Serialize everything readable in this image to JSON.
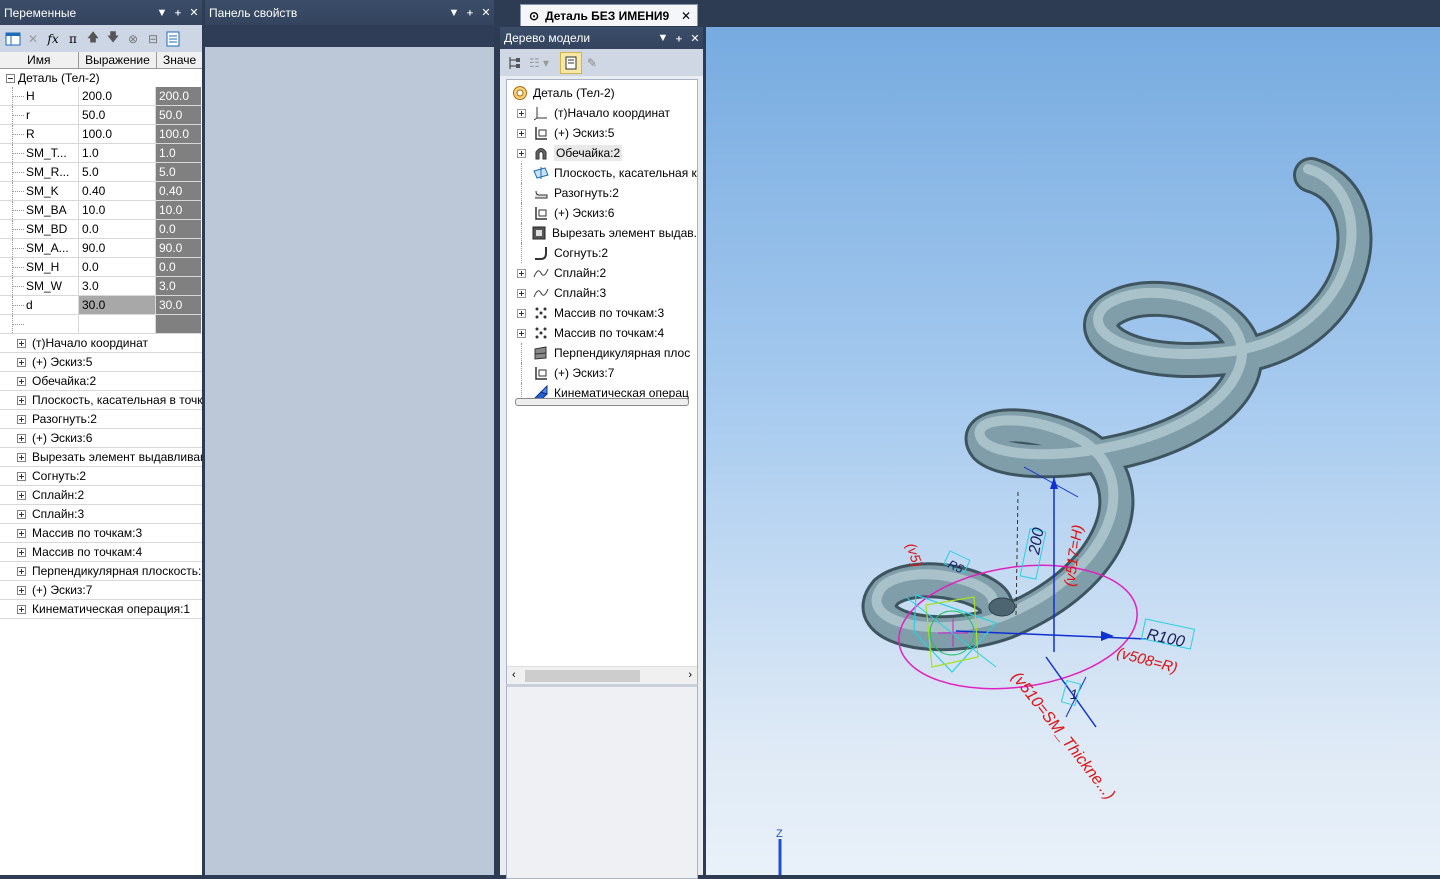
{
  "variables_panel": {
    "title": "Переменные",
    "columns": [
      "Имя",
      "Выражение",
      "Значе"
    ],
    "root": "Деталь (Тел-2)",
    "rows": [
      {
        "name": "H",
        "expr": "200.0",
        "value": "200.0"
      },
      {
        "name": "r",
        "expr": "50.0",
        "value": "50.0"
      },
      {
        "name": "R",
        "expr": "100.0",
        "value": "100.0"
      },
      {
        "name": "SM_T...",
        "expr": "1.0",
        "value": "1.0"
      },
      {
        "name": "SM_R...",
        "expr": "5.0",
        "value": "5.0"
      },
      {
        "name": "SM_K",
        "expr": "0.40",
        "value": "0.40"
      },
      {
        "name": "SM_BA",
        "expr": "10.0",
        "value": "10.0"
      },
      {
        "name": "SM_BD",
        "expr": "0.0",
        "value": "0.0"
      },
      {
        "name": "SM_A...",
        "expr": "90.0",
        "value": "90.0"
      },
      {
        "name": "SM_H",
        "expr": "0.0",
        "value": "0.0"
      },
      {
        "name": "SM_W",
        "expr": "3.0",
        "value": "3.0"
      },
      {
        "name": "d",
        "expr": "30.0",
        "value": "30.0"
      }
    ],
    "tree_items": [
      "(т)Начало координат",
      "(+) Эскиз:5",
      "Обечайка:2",
      "Плоскость, касательная в точк",
      "Разогнуть:2",
      "(+) Эскиз:6",
      "Вырезать элемент выдавливан",
      "Согнуть:2",
      "Сплайн:2",
      "Сплайн:3",
      "Массив по точкам:3",
      "Массив по точкам:4",
      "Перпендикулярная плоскость:",
      "(+) Эскиз:7",
      "Кинематическая операция:1"
    ]
  },
  "properties_panel": {
    "title": "Панель свойств"
  },
  "document_tab": {
    "label": "Деталь БЕЗ ИМЕНИ9"
  },
  "model_tree": {
    "title": "Дерево модели",
    "root": "Деталь (Тел-2)",
    "items": [
      {
        "label": "(т)Начало координат",
        "expand": true,
        "icon": "axes-icon"
      },
      {
        "label": "(+) Эскиз:5",
        "expand": true,
        "icon": "sketch-icon"
      },
      {
        "label": "Обечайка:2",
        "expand": true,
        "icon": "shell-icon",
        "selected": true
      },
      {
        "label": "Плоскость, касательная к",
        "expand": false,
        "icon": "plane-icon"
      },
      {
        "label": "Разогнуть:2",
        "expand": false,
        "icon": "unbend-icon"
      },
      {
        "label": "(+) Эскиз:6",
        "expand": false,
        "icon": "sketch-icon"
      },
      {
        "label": "Вырезать элемент выдав.",
        "expand": false,
        "icon": "cut-icon"
      },
      {
        "label": "Согнуть:2",
        "expand": false,
        "icon": "bend-icon"
      },
      {
        "label": "Сплайн:2",
        "expand": true,
        "icon": "spline-icon"
      },
      {
        "label": "Сплайн:3",
        "expand": true,
        "icon": "spline-icon"
      },
      {
        "label": "Массив по точкам:3",
        "expand": true,
        "icon": "array-icon"
      },
      {
        "label": "Массив по точкам:4",
        "expand": true,
        "icon": "array-icon"
      },
      {
        "label": "Перпендикулярная плос",
        "expand": false,
        "icon": "perp-plane-icon"
      },
      {
        "label": "(+) Эскиз:7",
        "expand": false,
        "icon": "sketch-icon"
      },
      {
        "label": "Кинематическая операц",
        "expand": false,
        "icon": "sweep-icon"
      }
    ]
  },
  "viewport": {
    "annotations": {
      "dim_h": "200",
      "dim_h_expr": "(v517=H)",
      "dim_r_big": "R100",
      "dim_r_big_expr": "(v508=R)",
      "dim_thickness": "1",
      "dim_thickness_expr": "(v510=SM_Thickne...)",
      "dim_left_expr": "(v5)",
      "dim_left_tag": "R5"
    },
    "axis_label": "Z"
  },
  "colors": {
    "panel_title_bg": "#35455f",
    "viewport_top": "#77abe0",
    "viewport_bottom": "#e6f0fa",
    "spring": "#7b9aa5",
    "dim_red": "#e01010",
    "dim_cyan": "#2bd0e0",
    "dim_blue": "#1030d0",
    "magenta": "#e020c0"
  }
}
